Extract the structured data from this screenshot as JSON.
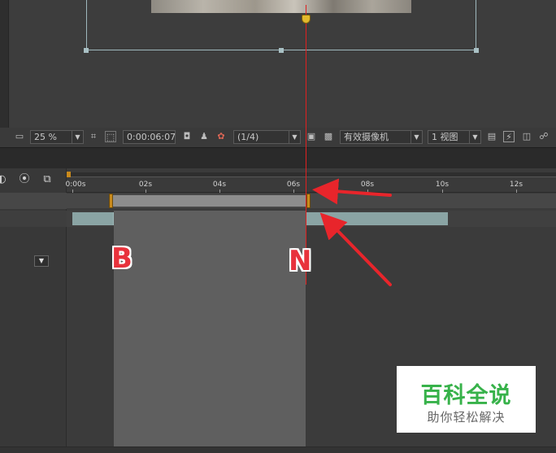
{
  "viewer": {
    "zoom": "25 %",
    "timecode": "0:00:06:07",
    "resolution": "(1/4)",
    "camera": "有效摄像机",
    "views": "1 视图"
  },
  "timeline": {
    "ruler_ticks": [
      "0:00s",
      "02s",
      "04s",
      "06s",
      "08s",
      "10s",
      "12s"
    ]
  },
  "annotations": {
    "marker_b": "B",
    "marker_n": "N",
    "arrow_color": "#e8252b"
  },
  "watermark": {
    "title": "百科全说",
    "subtitle": "助你轻松解决"
  },
  "colors": {
    "playhead": "#e02020",
    "work_area": "#c98a1c",
    "layer": "#8aa4a4"
  }
}
